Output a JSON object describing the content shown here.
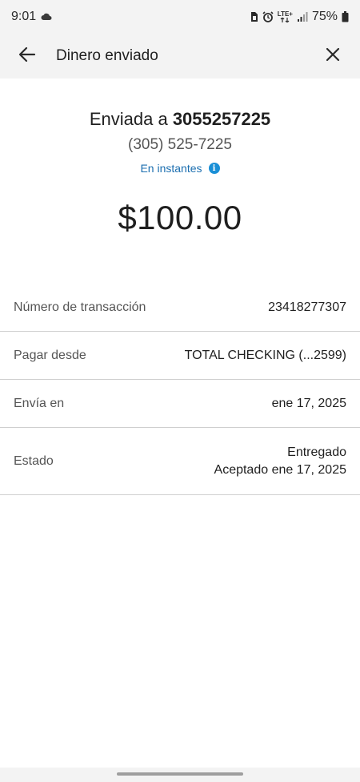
{
  "status_bar": {
    "time": "9:01",
    "battery": "75%",
    "network": "LTE+"
  },
  "header": {
    "title": "Dinero enviado"
  },
  "summary": {
    "sent_to_prefix": "Enviada a",
    "recipient": "3055257225",
    "phone": "(305) 525-7225",
    "timing": "En instantes",
    "amount": "$100.00"
  },
  "details": {
    "transaction_label": "Número de transacción",
    "transaction_value": "23418277307",
    "pay_from_label": "Pagar desde",
    "pay_from_value": "TOTAL CHECKING (...2599)",
    "sends_on_label": "Envía en",
    "sends_on_value": "ene 17, 2025",
    "status_label": "Estado",
    "status_value": "Entregado",
    "status_sub": "Aceptado ene 17, 2025"
  },
  "colors": {
    "accent": "#1c6fb0",
    "info_icon": "#1a8fd6",
    "header_bg": "#f3f3f3"
  }
}
